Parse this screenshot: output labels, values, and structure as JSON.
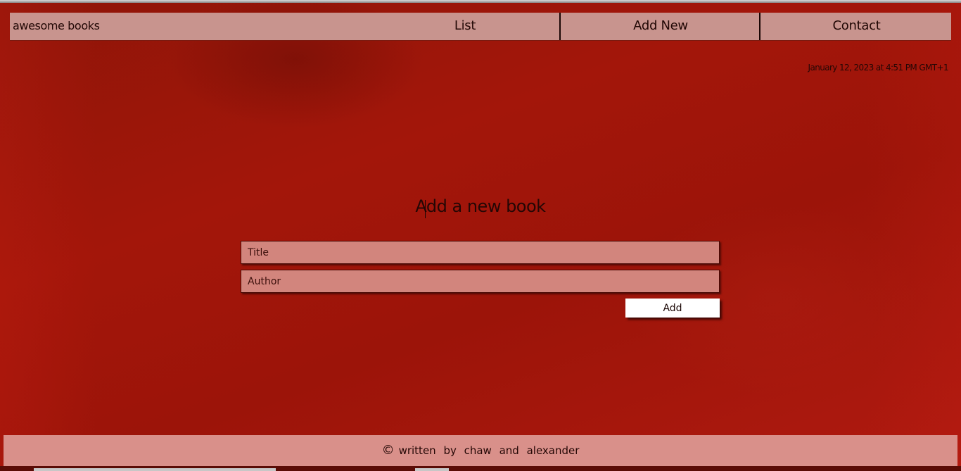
{
  "navbar": {
    "brand": "awesome books",
    "links": [
      "List",
      "Add New",
      "Contact"
    ]
  },
  "datetime": "January 12, 2023 at 4:51 PM GMT+1",
  "form": {
    "title": "Add a new book",
    "title_placeholder": "Title",
    "author_placeholder": "Author",
    "submit_label": "Add"
  },
  "footer": {
    "copyright_symbol": "©",
    "text": "written by chaw and alexander"
  },
  "colors": {
    "background": "#9c160b",
    "navbar": "#c8948e",
    "input": "#d2857d",
    "footer": "#d9908a",
    "button": "#ffffff"
  }
}
